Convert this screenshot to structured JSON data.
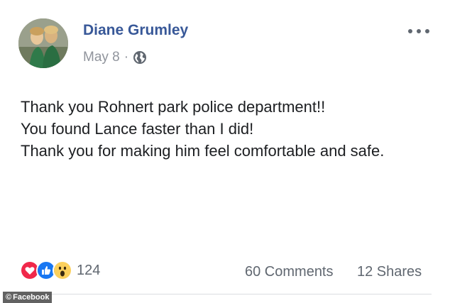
{
  "post": {
    "author": "Diane Grumley",
    "date": "May 8",
    "separator": "·",
    "privacy_icon": "globe-icon",
    "more_icon": "more-options-icon",
    "lines": [
      "Thank you Rohnert park police department!!",
      "You found Lance faster than I did!",
      "Thank you for making him feel comfortable and safe."
    ]
  },
  "footer": {
    "reactions": [
      "love",
      "like",
      "wow"
    ],
    "reaction_count": "124",
    "comments": "60 Comments",
    "shares": "12 Shares"
  },
  "credit": {
    "text": "Facebook",
    "symbol": "©"
  },
  "colors": {
    "author": "#385898",
    "meta": "#90949c",
    "love": "#f0284a",
    "like": "#1877f2",
    "wow": "#fcd05c"
  }
}
